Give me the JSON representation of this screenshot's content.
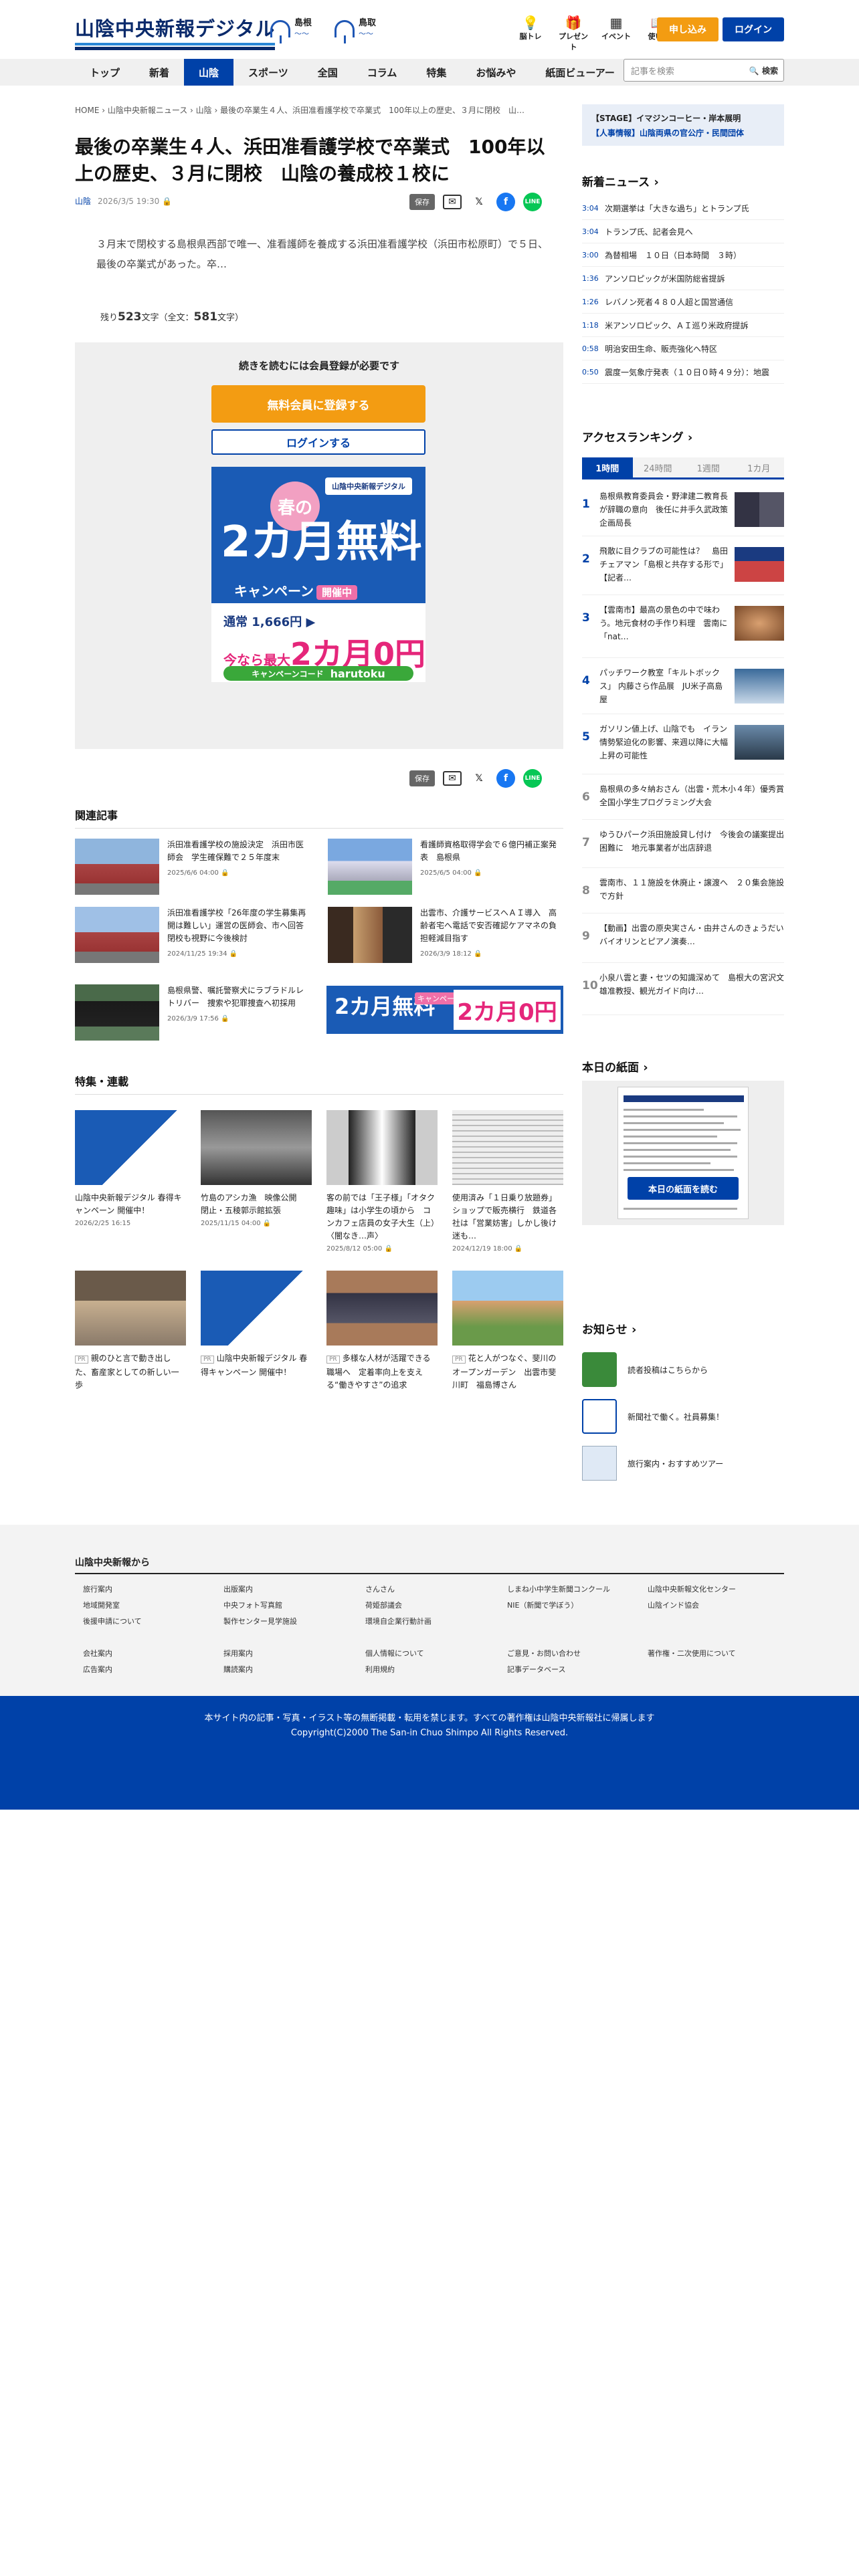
{
  "header": {
    "logo": "山陰中央新報デジタル",
    "weather": [
      {
        "name": "島根",
        "icon": "umbrella-icon"
      },
      {
        "name": "鳥取",
        "icon": "umbrella-icon"
      }
    ],
    "icons": [
      {
        "label": "脳トレ",
        "icon": "brain-icon"
      },
      {
        "label": "プレゼント",
        "icon": "gift-icon"
      },
      {
        "label": "イベント",
        "icon": "calendar-icon"
      },
      {
        "label": "使い方",
        "icon": "book-icon"
      }
    ],
    "subscribe": "申し込み",
    "login": "ログイン"
  },
  "nav": {
    "tabs": [
      "トップ",
      "新着",
      "山陰",
      "スポーツ",
      "全国",
      "コラム",
      "特集",
      "お悩みや",
      "紙面ビューアー"
    ],
    "active": 2,
    "search_placeholder": "記事を検索",
    "search_button": "検索"
  },
  "article": {
    "breadcrumb": "HOME › 山陰中央新報ニュース › 山陰 › 最後の卒業生４人、浜田准看護学校で卒業式　100年以上の歴史、３月に閉校　山…",
    "title": "最後の卒業生４人、浜田准看護学校で卒業式　100年以上の歴史、３月に閉校　山陰の養成校１校に",
    "category": "山陰",
    "date": "2026/3/5 19:30",
    "save": "保存",
    "lead": "３月末で閉校する島根県西部で唯一、准看護師を養成する浜田准看護学校（浜田市松原町）で５日、最後の卒業式があった。卒…",
    "remain_pre": "残り",
    "remain_num": "523",
    "remain_mid": "文字（全文：",
    "remain_total": "581",
    "remain_post": "文字）"
  },
  "paywall": {
    "prompt": "続きを読むには会員登録が必要です",
    "register": "無料会員に登録する",
    "login": "ログインする",
    "ad": {
      "brand": "山陰中央新報デジタル",
      "spring": "春の",
      "headline": "2カ月無料",
      "campaign": "キャンペーン",
      "pill": "開催中",
      "price_line": "通常 1,666円 ▶",
      "discount_pre": "今なら最大",
      "discount_big": "2カ月0円",
      "code_label": "キャンペーンコード",
      "code": "harutoku"
    }
  },
  "related": {
    "heading": "関連記事",
    "items": [
      {
        "title": "浜田准看護学校の施設決定　浜田市医師会　学生確保難で２５年度末",
        "date": "2025/6/6 04:00"
      },
      {
        "title": "看護師資格取得学会で６億円補正案発表　島根県",
        "date": "2025/6/5 04:00"
      },
      {
        "title": "浜田准看護学校「26年度の学生募集再開は難しい」運営の医師会、市へ回答　閉校も視野に今後検討",
        "date": "2024/11/25 19:34"
      },
      {
        "title": "出雲市、介護サービスへＡＩ導入　高齢者宅へ電話で安否確認ケアマネの負担軽減目指す",
        "date": "2026/3/9 18:12"
      },
      {
        "title": "島根県警、嘱託警察犬にラブラドルレトリバー　捜索や犯罪捜査へ初採用",
        "date": "2026/3/9 17:56"
      }
    ],
    "ad_text": "2カ月無料",
    "ad_badge": "キャンペーン"
  },
  "features": {
    "heading": "特集・連載",
    "items": [
      {
        "title": "山陰中央新報デジタル 春得キャンペーン 開催中！",
        "date": "2026/2/25 16:15",
        "pr": false
      },
      {
        "title": "竹島のアシカ漁　映像公開　閉止・五稜郭示館拡張",
        "date": "2025/11/15 04:00",
        "pr": false
      },
      {
        "title": "客の前では「王子様」「オタク趣味」は小学生の頃から　コンカフェ店員の女子大生（上）〈闇なき…声〉",
        "date": "2025/8/12 05:00",
        "pr": false
      },
      {
        "title": "使用済み「１日乗り放題券」ショップで販売横行　鉄道各社は「営業妨害」しかし後け迷も…",
        "date": "2024/12/19 18:00",
        "pr": false
      },
      {
        "title": "親のひと言で動き出した、畜産家としての新しい一歩",
        "date": "",
        "pr": true
      },
      {
        "title": "山陰中央新報デジタル 春得キャンペーン 開催中！",
        "date": "",
        "pr": true
      },
      {
        "title": "多様な人材が活躍できる職場へ　定着率向上を支える“働きやすさ”の追求",
        "date": "",
        "pr": true
      },
      {
        "title": "花と人がつなぐ、斐川のオープンガーデン　出雲市斐川町　福島博さん",
        "date": "",
        "pr": true
      }
    ]
  },
  "sidebar": {
    "banner_line1": "【STAGE】イマジンコーヒー・岸本展明",
    "banner_line2": "【人事情報】山陰両県の官公庁・民間団体",
    "news_heading": "新着ニュース",
    "news": [
      {
        "time": "3:04",
        "title": "次期選挙は「大きな過ち」とトランプ氏"
      },
      {
        "time": "3:04",
        "title": "トランプ氏、記者会見へ"
      },
      {
        "time": "3:00",
        "title": "為替相場　１０日（日本時間　３時）"
      },
      {
        "time": "1:36",
        "title": "アンソロピックが米国防総省提訴"
      },
      {
        "time": "1:26",
        "title": "レバノン死者４８０人超と国営通信"
      },
      {
        "time": "1:18",
        "title": "米アンソロピック、ＡＩ巡り米政府提訴"
      },
      {
        "time": "0:58",
        "title": "明治安田生命、販売強化へ特区"
      },
      {
        "time": "0:50",
        "title": "震度一気象庁発表（１０日０時４９分）：地震"
      }
    ],
    "ranking_heading": "アクセスランキング",
    "ranking_tabs": [
      "1時間",
      "24時間",
      "1週間",
      "1カ月"
    ],
    "ranking": [
      {
        "n": "1",
        "title": "島根県教育委員会・野津建二教育長が辞職の意向　後任に井手久武政策企画局長"
      },
      {
        "n": "2",
        "title": "飛散に⽬クラブの可能性は？　島田チェアマン「島根と共存する形で」【記者…"
      },
      {
        "n": "3",
        "title": "【雲南市】最高の景色の中で味わう。地元食材の手作り料理　雲南に「nat…"
      },
      {
        "n": "4",
        "title": "パッチワーク教室「キルトボックス」 内藤さら作品展　JU米子高島屋"
      },
      {
        "n": "5",
        "title": "ガソリン値上げ、山陰でも　イラン情勢緊迫化の影響、来週以降に大幅上昇の可能性"
      },
      {
        "n": "6",
        "title": "島根県の多々納おさん（出雲・荒木小４年）優秀賞　全国小学生プログラミング大会"
      },
      {
        "n": "7",
        "title": "ゆうひパーク浜田施設貸し付け　今後会の議案提出困難に　地元事業者が出店辞退"
      },
      {
        "n": "8",
        "title": "雲南市、１１施設を休廃止・譲渡へ　２０集会施設で方針"
      },
      {
        "n": "9",
        "title": "【動画】出雲の原央実さん・由井さんのきょうだい　バイオリンとピアノ演奏…"
      },
      {
        "n": "10",
        "title": "小泉八雲と妻・セツの知識深めて　島根大の宮沢文雄准教授、観光ガイド向け…"
      }
    ],
    "paper_heading": "本日の紙面",
    "paper_button": "本日の紙面を読む",
    "info_heading": "お知らせ",
    "info": [
      {
        "label": "読者投稿はこちらから",
        "icon": "mail-icon"
      },
      {
        "label": "新聞社で働く。社員募集！",
        "icon": "recruit-icon"
      },
      {
        "label": "旅行案内・おすすめツアー",
        "icon": "travel-icon"
      }
    ]
  },
  "footer": {
    "heading": "山陰中央新報から",
    "links": [
      "旅行案内",
      "出版案内",
      "さんさん",
      "しまね小中学生新聞コンクール",
      "山陰中央新報文化センター",
      "地域開発室",
      "中央フォト写真館",
      "荷姫部議会",
      "NIE（新聞で学ぼう）",
      "山陰インド協会",
      "後援申請について",
      "製作センター見学施設",
      "環境自企業行動計画",
      "会社案内",
      "採用案内",
      "個人情報について",
      "ご意見・お問い合わせ",
      "著作権・二次使用について",
      "広告案内",
      "購読案内",
      "利用規約",
      "記事データベース"
    ],
    "copy1": "本サイト内の記事・写真・イラスト等の無断掲載・転用を禁じます。すべての著作権は山陰中央新報社に帰属します",
    "copy2": "Copyright(C)2000 The San-in Chuo Shimpo All Rights Reserved."
  },
  "colors": {
    "brand": "#0041a8",
    "accent": "#f39c12",
    "pink": "#e5267a"
  }
}
